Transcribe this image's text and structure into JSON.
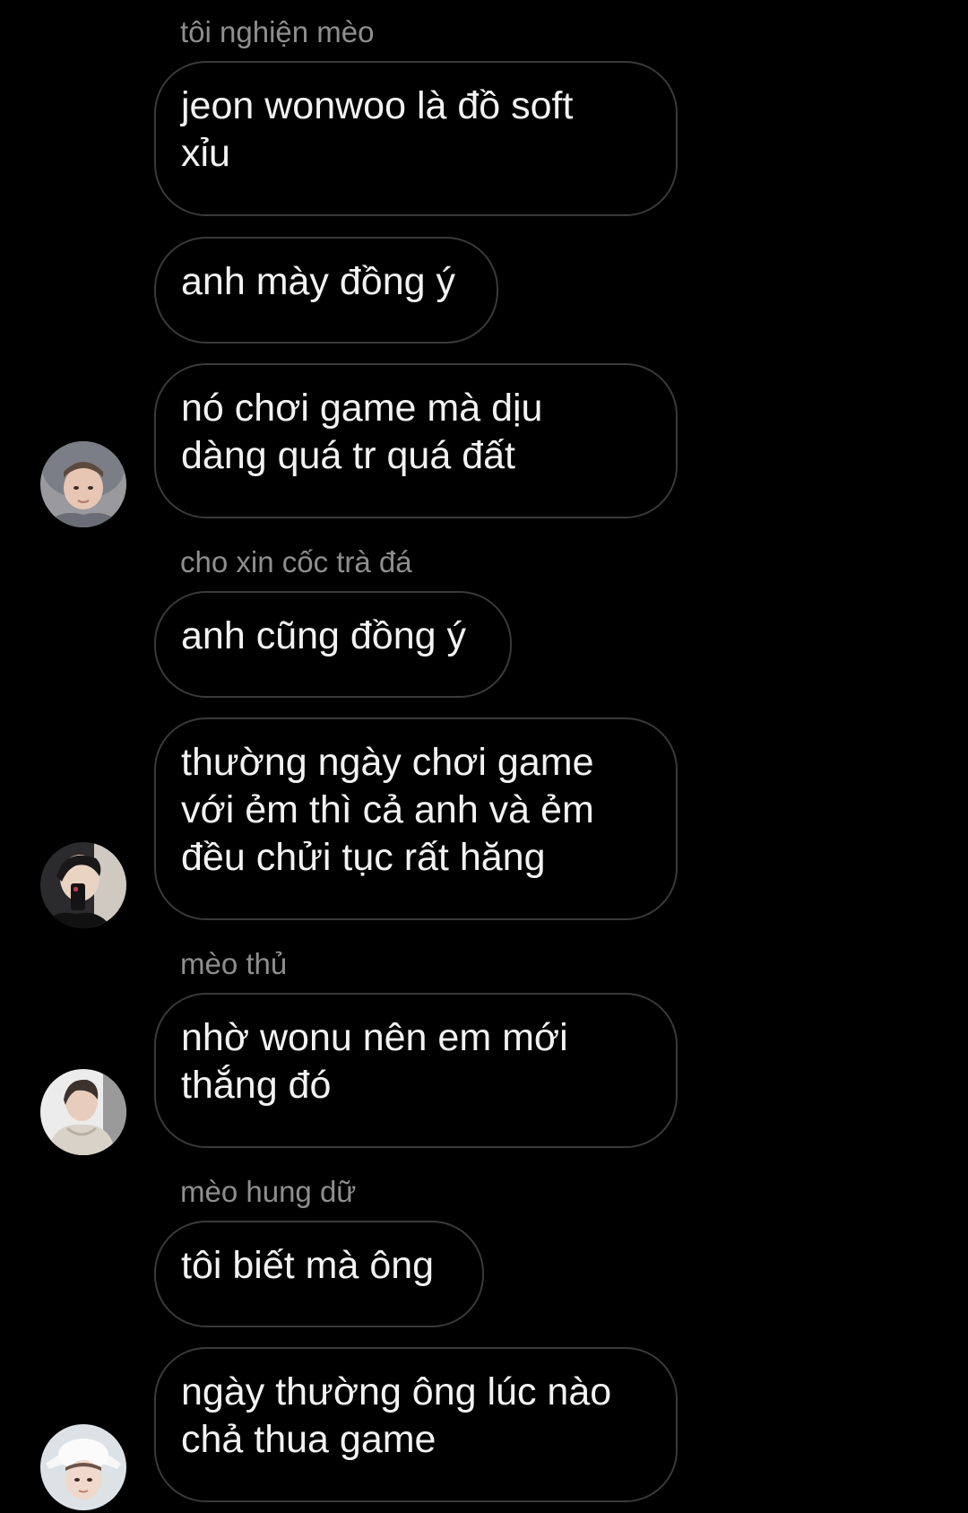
{
  "threads": [
    {
      "sender": "tôi nghiện mèo",
      "messages": [
        "jeon wonwoo là đồ soft\nxỉu",
        "anh mày đồng ý",
        "nó chơi game mà dịu\ndàng quá tr quá đất"
      ]
    },
    {
      "sender": "cho xin cốc trà đá",
      "messages": [
        "anh cũng đồng ý",
        "thường ngày chơi game\nvới ẻm thì cả anh và ẻm\nđều chửi tục rất hăng"
      ]
    },
    {
      "sender": "mèo thủ",
      "messages": [
        "nhờ wonu nên em mới\nthắng đó"
      ]
    },
    {
      "sender": "mèo hung dữ",
      "messages": [
        "tôi biết mà ông",
        "ngày thường ông lúc nào\nchả thua game"
      ]
    }
  ],
  "colors": {
    "background": "#000000",
    "bubble_border": "#3a3a3a",
    "sender_name": "#8e8e8e",
    "message_text": "#f2f2f2"
  },
  "icons": {
    "avatar_1": "user-avatar-photo",
    "avatar_2": "user-avatar-photo",
    "avatar_3": "user-avatar-photo",
    "avatar_4": "user-avatar-photo"
  }
}
